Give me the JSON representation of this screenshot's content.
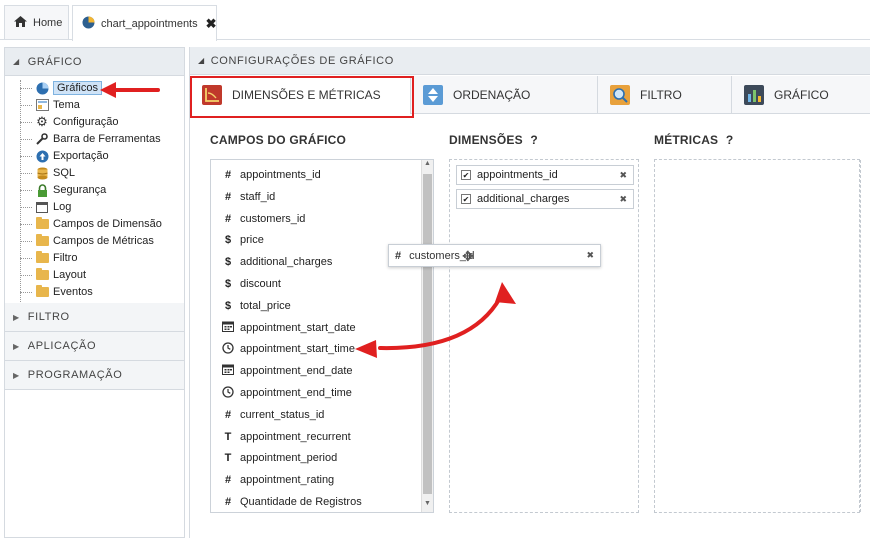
{
  "tabs": {
    "home_label": "Home",
    "chart_label": "chart_appointments",
    "close_glyph": "✖"
  },
  "sidebar": {
    "section_title": "GRÁFICO",
    "items": [
      {
        "label": "Gráficos",
        "icon": "pie-chart-icon"
      },
      {
        "label": "Tema",
        "icon": "theme-icon"
      },
      {
        "label": "Configuração",
        "icon": "gear-icon"
      },
      {
        "label": "Barra de Ferramentas",
        "icon": "wrench-icon"
      },
      {
        "label": "Exportação",
        "icon": "upload-icon"
      },
      {
        "label": "SQL",
        "icon": "database-icon"
      },
      {
        "label": "Segurança",
        "icon": "lock-icon"
      },
      {
        "label": "Log",
        "icon": "log-icon"
      },
      {
        "label": "Campos de Dimensão",
        "icon": "folder-icon"
      },
      {
        "label": "Campos de Métricas",
        "icon": "folder-icon"
      },
      {
        "label": "Filtro",
        "icon": "folder-icon"
      },
      {
        "label": "Layout",
        "icon": "folder-icon"
      },
      {
        "label": "Eventos",
        "icon": "folder-icon"
      }
    ],
    "collapsed": [
      "FILTRO",
      "APLICAÇÃO",
      "PROGRAMAÇÃO"
    ]
  },
  "main": {
    "header": "CONFIGURAÇÕES DE GRÁFICO",
    "subtabs": [
      {
        "label": "DIMENSÕES E MÉTRICAS"
      },
      {
        "label": "ORDENAÇÃO"
      },
      {
        "label": "FILTRO"
      },
      {
        "label": "GRÁFICO"
      }
    ],
    "fields_title": "CAMPOS DO GRÁFICO",
    "dimensions_title": "DIMENSÕES",
    "metrics_title": "MÉTRICAS",
    "help_glyph": "?",
    "fields": [
      {
        "type": "#",
        "name": "appointments_id"
      },
      {
        "type": "#",
        "name": "staff_id"
      },
      {
        "type": "#",
        "name": "customers_id"
      },
      {
        "type": "$",
        "name": "price"
      },
      {
        "type": "$",
        "name": "additional_charges"
      },
      {
        "type": "$",
        "name": "discount"
      },
      {
        "type": "$",
        "name": "total_price"
      },
      {
        "type": "date",
        "name": "appointment_start_date"
      },
      {
        "type": "time",
        "name": "appointment_start_time"
      },
      {
        "type": "date",
        "name": "appointment_end_date"
      },
      {
        "type": "time",
        "name": "appointment_end_time"
      },
      {
        "type": "#",
        "name": "current_status_id"
      },
      {
        "type": "T",
        "name": "appointment_recurrent"
      },
      {
        "type": "T",
        "name": "appointment_period"
      },
      {
        "type": "#",
        "name": "appointment_rating"
      },
      {
        "type": "#",
        "name": "Quantidade de Registros"
      }
    ],
    "dimensions": [
      {
        "name": "appointments_id"
      },
      {
        "name": "additional_charges"
      }
    ],
    "dragging": {
      "type": "#",
      "name": "customers_id"
    },
    "remove_glyph": "✖"
  }
}
